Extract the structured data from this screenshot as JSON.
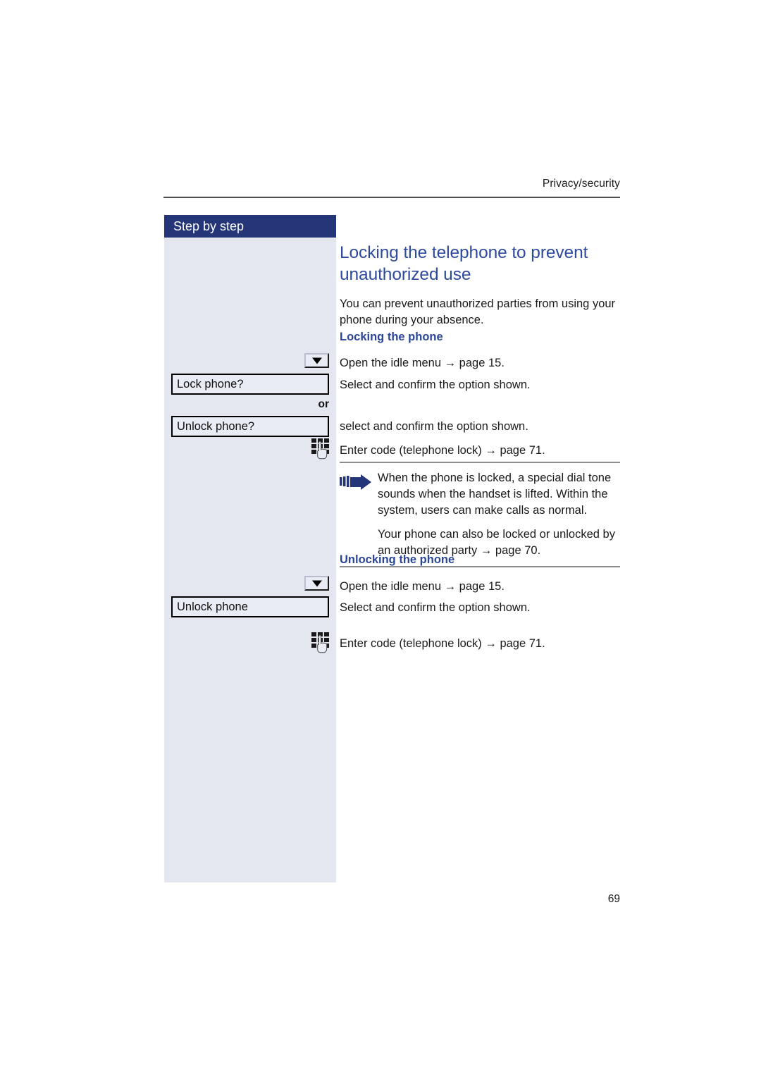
{
  "page": {
    "running_header": "Privacy/security",
    "page_number": "69",
    "accent_navy": "#243578",
    "accent_blue": "#2e4a9e",
    "sidebar_bg": "#e4e7f0"
  },
  "sidebar": {
    "title": "Step by step",
    "or_label": "or",
    "display_options": [
      {
        "label": "Lock phone?"
      },
      {
        "label": "Unlock phone?"
      },
      {
        "label": "Unlock phone"
      }
    ],
    "icons": [
      {
        "name": "down-key-icon"
      },
      {
        "name": "keypad-icon"
      }
    ]
  },
  "content": {
    "title": "Locking the telephone to prevent unauthorized use",
    "intro": "You can prevent unauthorized parties from using your phone during your absence.",
    "section_locking": {
      "heading": "Locking the phone",
      "steps": [
        "Open the idle menu → page 15.",
        "Select and confirm the option shown.",
        "select and confirm the option shown.",
        "Enter code (telephone lock) → page 71."
      ]
    },
    "note": {
      "paragraph_1": "When the phone is locked, a special dial tone sounds when the handset is lifted. Within the system, users can make calls as normal.",
      "paragraph_2": "Your phone can also be locked or unlocked by an authorized party → page 70."
    },
    "section_unlocking": {
      "heading": "Unlocking the phone",
      "steps": [
        "Open the idle menu → page 15.",
        "Select and confirm the option shown.",
        "Enter code (telephone lock) → page 71."
      ]
    }
  }
}
